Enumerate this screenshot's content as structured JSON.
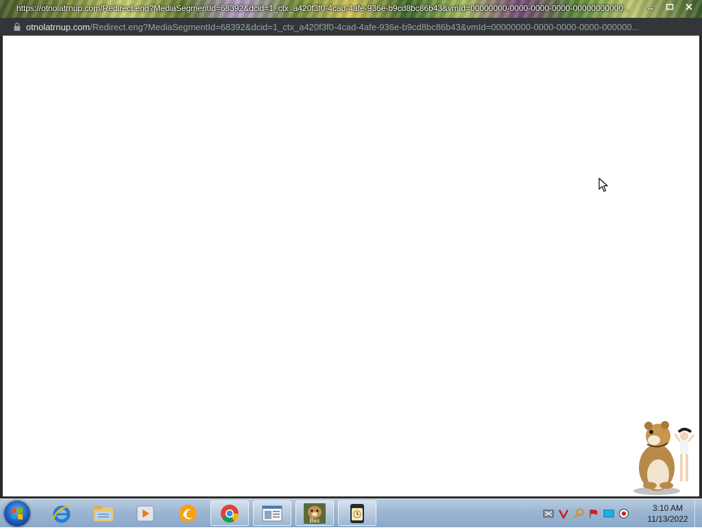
{
  "window": {
    "title": "https://otnolatrnup.com/Redirect.eng?MediaSegmentId=68392&dcid=1_ctx_a420f3f0-4cad-4afe-936e-b9cd8bc86b43&vmId=00000000-0000-0000-0000-00000000000..."
  },
  "address_bar": {
    "host": "otnolatrnup.com",
    "path": "/Redirect.eng?MediaSegmentId=68392&dcid=1_ctx_a420f3f0-4cad-4afe-936e-b9cd8bc86b43&vmId=00000000-0000-0000-0000-000000..."
  },
  "taskbar": {
    "items": [
      {
        "name": "internet-explorer-icon"
      },
      {
        "name": "windows-explorer-icon"
      },
      {
        "name": "media-player-icon"
      },
      {
        "name": "uc-browser-icon"
      },
      {
        "name": "chrome-icon"
      },
      {
        "name": "document-window-icon"
      },
      {
        "name": "box-app-icon",
        "label": "Box"
      },
      {
        "name": "clock-app-icon"
      }
    ],
    "tray": [
      "network-icon",
      "antivirus-v-icon",
      "search-key-icon",
      "action-center-flag-icon",
      "display-icon",
      "volume-icon"
    ],
    "clock": {
      "time": "3:10 AM",
      "date": "11/13/2022"
    }
  },
  "colors": {
    "address_bar_bg": "#323639",
    "taskbar_bg": "#9cb6d2",
    "content_bg": "#ffffff"
  }
}
